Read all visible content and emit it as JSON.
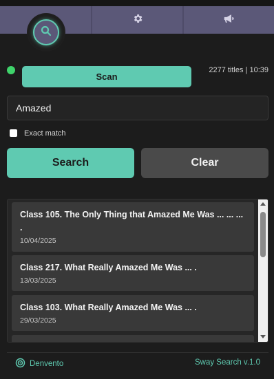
{
  "nav": {
    "tabs": [
      {
        "name": "search",
        "icon": "search-icon",
        "active": true
      },
      {
        "name": "settings",
        "icon": "gear-icon",
        "active": false
      },
      {
        "name": "announcements",
        "icon": "megaphone-icon",
        "active": false
      }
    ]
  },
  "scan": {
    "label": "Scan",
    "status_color": "#3fd36b",
    "stats": "2277 titles | 10:39"
  },
  "search": {
    "query": "Amazed",
    "exact_match_label": "Exact match",
    "exact_match_checked": false,
    "search_label": "Search",
    "clear_label": "Clear"
  },
  "results": [
    {
      "title": "Class 105. The Only Thing that Amazed Me Was ... ... ... .",
      "date": "10/04/2025"
    },
    {
      "title": "Class 217. What Really Amazed Me Was ... .",
      "date": "13/03/2025"
    },
    {
      "title": "Class 103. What Really Amazed Me Was ... .",
      "date": "29/03/2025"
    }
  ],
  "footer": {
    "brand": "Denvento",
    "version": "Sway Search v.1.0"
  },
  "colors": {
    "accent": "#5fcab1",
    "nav_bg": "#5b5878",
    "background": "#1c1c1c"
  }
}
